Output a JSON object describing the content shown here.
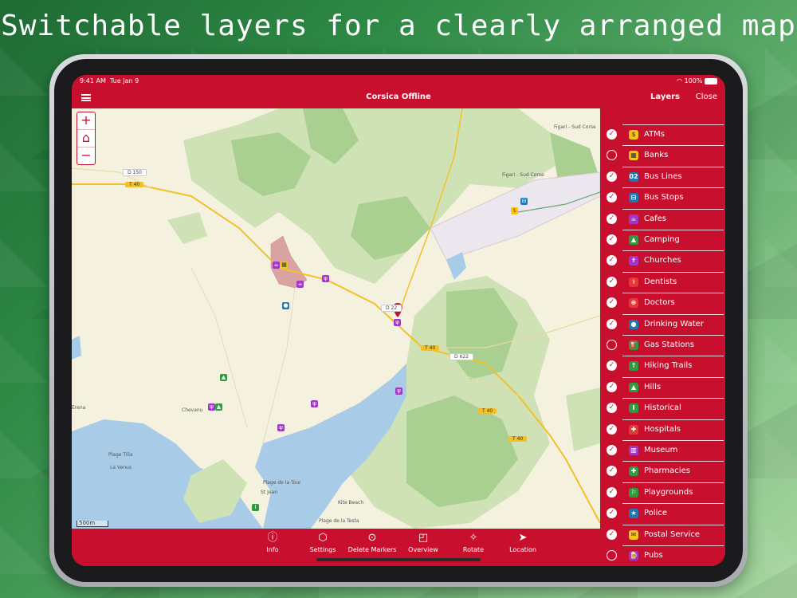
{
  "headline": "Switchable layers for a clearly arranged map",
  "status": {
    "time": "9:41 AM",
    "date": "Tue Jan 9",
    "battery": "100%"
  },
  "nav": {
    "title": "Corsica Offline",
    "layers_title": "Layers",
    "close_label": "Close"
  },
  "map": {
    "zoom_in": "+",
    "zoom_out": "−",
    "scale": "500m",
    "road_labels": [
      "D 150",
      "T 40",
      "D 22",
      "T 40",
      "D 622",
      "T 40",
      "T 40"
    ],
    "place_labels": [
      "Figari - Sud Corse",
      "Figari - Sud Corse",
      "Plage de la Tour",
      "St Jean",
      "Kite Beach",
      "Plage de la Testa",
      "Chevanu",
      "Plage Tilia",
      "La Venus",
      "Erena"
    ],
    "colors": {
      "land": "#f5f1df",
      "forest": "#cfe2b5",
      "dense_forest": "#a9cf91",
      "water": "#a8cbe8",
      "road": "#f3c028"
    }
  },
  "layers": [
    {
      "label": "ATMs",
      "checked": true,
      "icon": "atm-icon",
      "glyph": "$",
      "color": "#f5c518",
      "fg": "#8a5a00"
    },
    {
      "label": "Banks",
      "checked": false,
      "icon": "bank-icon",
      "glyph": "▦",
      "color": "#f5c518",
      "fg": "#333"
    },
    {
      "label": "Bus Lines",
      "checked": true,
      "icon": "bus-line-icon",
      "glyph": "02",
      "color": "#1f78b4",
      "fg": "#fff"
    },
    {
      "label": "Bus Stops",
      "checked": true,
      "icon": "bus-stop-icon",
      "glyph": "⊟",
      "color": "#1f78b4",
      "fg": "#fff"
    },
    {
      "label": "Cafes",
      "checked": true,
      "icon": "cafe-icon",
      "glyph": "☕",
      "color": "#a335c9",
      "fg": "#fff"
    },
    {
      "label": "Camping",
      "checked": true,
      "icon": "camping-icon",
      "glyph": "▲",
      "color": "#2e9b3e",
      "fg": "#fff"
    },
    {
      "label": "Churches",
      "checked": true,
      "icon": "church-icon",
      "glyph": "✝",
      "color": "#a335c9",
      "fg": "#fff"
    },
    {
      "label": "Dentists",
      "checked": true,
      "icon": "dentist-icon",
      "glyph": "⚕",
      "color": "#e53935",
      "fg": "#fff"
    },
    {
      "label": "Doctors",
      "checked": true,
      "icon": "doctor-icon",
      "glyph": "⊕",
      "color": "#e53935",
      "fg": "#fff"
    },
    {
      "label": "Drinking Water",
      "checked": true,
      "icon": "drinking-water-icon",
      "glyph": "●",
      "color": "#1f78b4",
      "fg": "#fff"
    },
    {
      "label": "Gas Stations",
      "checked": false,
      "icon": "gas-station-icon",
      "glyph": "⛽",
      "color": "#2e9b3e",
      "fg": "#fff"
    },
    {
      "label": "Hiking Trails",
      "checked": true,
      "icon": "hiking-icon",
      "glyph": "↑",
      "color": "#2e9b3e",
      "fg": "#fff"
    },
    {
      "label": "Hills",
      "checked": true,
      "icon": "hill-icon",
      "glyph": "▲",
      "color": "#2e9b3e",
      "fg": "#fff"
    },
    {
      "label": "Historical",
      "checked": true,
      "icon": "historical-icon",
      "glyph": "I",
      "color": "#2e9b3e",
      "fg": "#fff"
    },
    {
      "label": "Hospitals",
      "checked": true,
      "icon": "hospital-icon",
      "glyph": "✚",
      "color": "#e53935",
      "fg": "#fff"
    },
    {
      "label": "Museum",
      "checked": true,
      "icon": "museum-icon",
      "glyph": "▥",
      "color": "#a335c9",
      "fg": "#fff"
    },
    {
      "label": "Pharmacies",
      "checked": true,
      "icon": "pharmacy-icon",
      "glyph": "✚",
      "color": "#2e9b3e",
      "fg": "#fff"
    },
    {
      "label": "Playgrounds",
      "checked": true,
      "icon": "playground-icon",
      "glyph": "⚐",
      "color": "#2e9b3e",
      "fg": "#fff"
    },
    {
      "label": "Police",
      "checked": true,
      "icon": "police-icon",
      "glyph": "★",
      "color": "#1f78b4",
      "fg": "#fff"
    },
    {
      "label": "Postal Service",
      "checked": true,
      "icon": "postal-icon",
      "glyph": "✉",
      "color": "#f5c518",
      "fg": "#333"
    },
    {
      "label": "Pubs",
      "checked": false,
      "icon": "pub-icon",
      "glyph": "🍺",
      "color": "#a335c9",
      "fg": "#fff"
    }
  ],
  "toolbar": [
    {
      "label": "Info",
      "icon": "info-icon",
      "glyph": "ⓘ"
    },
    {
      "label": "Settings",
      "icon": "settings-icon",
      "glyph": "⬡"
    },
    {
      "label": "Delete Markers",
      "icon": "delete-markers-icon",
      "glyph": "⊙"
    },
    {
      "label": "Overview",
      "icon": "overview-icon",
      "glyph": "◰"
    },
    {
      "label": "Rotate",
      "icon": "rotate-icon",
      "glyph": "✧"
    },
    {
      "label": "Location",
      "icon": "location-icon",
      "glyph": "➤"
    }
  ],
  "accent_color": "#c8102e"
}
